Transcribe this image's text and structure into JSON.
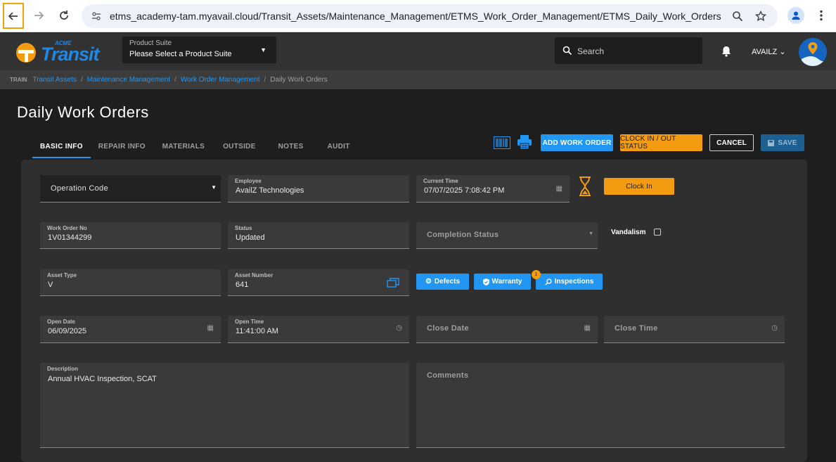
{
  "browser": {
    "url": "etms_academy-tam.myavail.cloud/Transit_Assets/Maintenance_Management/ETMS_Work_Order_Management/ETMS_Daily_Work_Orders"
  },
  "header": {
    "logo_small": "ACME",
    "logo_main": "Transit",
    "product_suite_label": "Product Suite",
    "product_suite_value": "Please Select a Product Suite",
    "search_placeholder": "Search",
    "user": "AVAILZ"
  },
  "breadcrumb": {
    "env": "TRAIN",
    "items": [
      "Transit Assets",
      "Maintenance Management",
      "Work Order Management"
    ],
    "current": "Daily Work Orders"
  },
  "page": {
    "title": "Daily Work Orders",
    "tabs": [
      "BASIC INFO",
      "REPAIR INFO",
      "MATERIALS",
      "OUTSIDE",
      "NOTES",
      "AUDIT"
    ],
    "active_tab": "BASIC INFO"
  },
  "toolbar": {
    "add_work_order": "ADD WORK ORDER",
    "clock_status": "CLOCK IN / OUT STATUS",
    "cancel": "CANCEL",
    "save": "SAVE"
  },
  "form": {
    "operation_code": "Operation Code",
    "employee": {
      "label": "Employee",
      "value": "AvailZ Technologies"
    },
    "current_time": {
      "label": "Current Time",
      "value": "07/07/2025 7:08:42 PM"
    },
    "clock_in": "Clock In",
    "work_order_no": {
      "label": "Work Order No",
      "value": "1V01344299"
    },
    "status": {
      "label": "Status",
      "value": "Updated"
    },
    "completion_status": "Completion Status",
    "vandalism": "Vandalism",
    "asset_type": {
      "label": "Asset Type",
      "value": "V"
    },
    "asset_number": {
      "label": "Asset Number",
      "value": "641"
    },
    "defects": "Defects",
    "warranty": "Warranty",
    "inspections": "Inspections",
    "inspections_badge": "1",
    "open_date": {
      "label": "Open Date",
      "value": "06/09/2025"
    },
    "open_time": {
      "label": "Open Time",
      "value": "11:41:00 AM"
    },
    "close_date": "Close Date",
    "close_time": "Close Time",
    "description": {
      "label": "Description",
      "value": "Annual HVAC Inspection, SCAT"
    },
    "comments": "Comments"
  },
  "colors": {
    "accent_blue": "#2196f3",
    "accent_orange": "#f39c12"
  }
}
